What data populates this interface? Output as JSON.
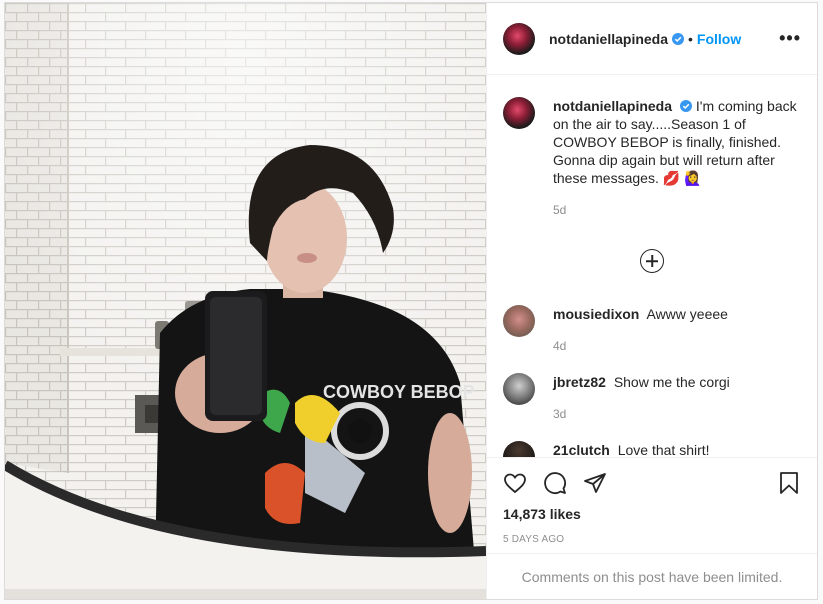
{
  "post": {
    "username": "notdaniellapineda",
    "follow_label": "Follow",
    "separator": "•",
    "more_label": "•••",
    "caption": {
      "username": "notdaniellapineda",
      "text": "I'm coming back on the air to say.....Season 1 of COWBOY BEBOP is finally, finished. Gonna dip again but will return after these messages. 💋 🙋‍♀️",
      "age": "5d"
    },
    "comments": [
      {
        "username": "mousiedixon",
        "text": "Awww yeeee",
        "age": "4d"
      },
      {
        "username": "jbretz82",
        "text": "Show me the corgi",
        "age": "3d"
      },
      {
        "username": "21clutch",
        "text": "Love that shirt!",
        "age": ""
      }
    ],
    "likes": "14,873 likes",
    "date": "5 DAYS AGO",
    "limited_notice": "Comments on this post have been limited."
  },
  "photo": {
    "shirt_print_title": "COWBOY BEBOP"
  },
  "colors": {
    "accent": "#0095f6",
    "verified": "#3897f0",
    "muted": "#8e8e8e"
  }
}
